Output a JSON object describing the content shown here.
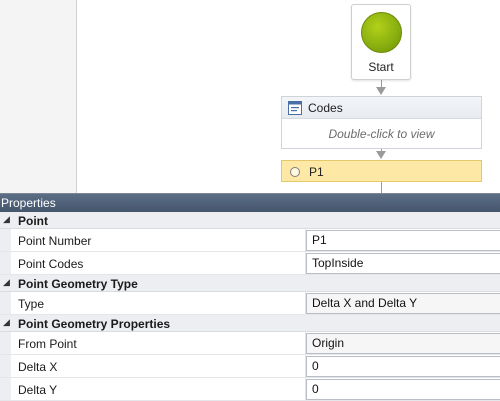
{
  "workflow": {
    "start_label": "Start",
    "codes_title": "Codes",
    "codes_hint": "Double-click to view",
    "p1_title": "P1"
  },
  "properties": {
    "title": "Properties",
    "categories": [
      {
        "label": "Point",
        "rows": [
          {
            "name": "Point Number",
            "value": "P1"
          },
          {
            "name": "Point Codes",
            "value": "TopInside"
          }
        ]
      },
      {
        "label": "Point Geometry Type",
        "rows": [
          {
            "name": "Type",
            "value": "Delta X and Delta Y"
          }
        ]
      },
      {
        "label": "Point Geometry Properties",
        "rows": [
          {
            "name": "From Point",
            "value": "Origin"
          },
          {
            "name": "Delta X",
            "value": "0"
          },
          {
            "name": "Delta Y",
            "value": "0"
          }
        ]
      }
    ]
  },
  "colors": {
    "start_green": "#8bb110",
    "selected_activity": "#fde8a6",
    "panel_header": "#4d5f77"
  }
}
